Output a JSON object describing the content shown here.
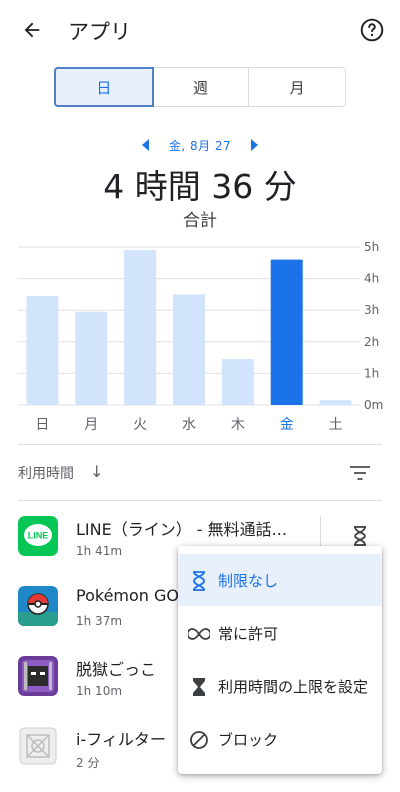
{
  "header": {
    "title": "アプリ",
    "back_icon": "arrow-left-icon",
    "help_icon": "help-circle-icon"
  },
  "segment": {
    "tabs": [
      "日",
      "週",
      "月"
    ],
    "selected": "日"
  },
  "date_nav": {
    "label": "金, 8月 27"
  },
  "summary": {
    "total": "4 時間 36 分",
    "label": "合計"
  },
  "chart_data": {
    "type": "bar",
    "categories": [
      "日",
      "月",
      "火",
      "水",
      "木",
      "金",
      "土"
    ],
    "values": [
      3.45,
      2.95,
      4.9,
      3.5,
      1.45,
      4.6,
      0.15
    ],
    "selected_index": 5,
    "y_ticks": [
      "0m",
      "1h",
      "2h",
      "3h",
      "4h",
      "5h"
    ],
    "ylim": [
      0,
      5
    ],
    "unit": "hours",
    "colors": {
      "bar": "#d2e3fc",
      "selected": "#1a73e8",
      "selected_label": "#1a73e8"
    }
  },
  "sort": {
    "label": "利用時間",
    "arrow": "↓"
  },
  "apps": [
    {
      "name": "LINE（ライン） - 無料通話...",
      "time": "1h 41m",
      "icon": "line-app-icon"
    },
    {
      "name": "Pokémon GO",
      "time": "1h 37m",
      "icon": "pokemon-go-app-icon"
    },
    {
      "name": "脱獄ごっこ",
      "time": "1h 10m",
      "icon": "dasugokugokko-app-icon"
    },
    {
      "name": "i-フィルター",
      "time": "2 分",
      "icon": "i-filter-app-icon"
    }
  ],
  "menu": {
    "items": [
      {
        "label": "制限なし",
        "icon": "hourglass-icon",
        "selected": true
      },
      {
        "label": "常に許可",
        "icon": "infinity-icon",
        "selected": false
      },
      {
        "label": "利用時間の上限を設定",
        "icon": "hourglass-icon",
        "selected": false
      },
      {
        "label": "ブロック",
        "icon": "block-icon",
        "selected": false
      }
    ]
  },
  "colors": {
    "accent": "#1a73e8",
    "text": "#202124",
    "secondary": "#5f6368"
  }
}
